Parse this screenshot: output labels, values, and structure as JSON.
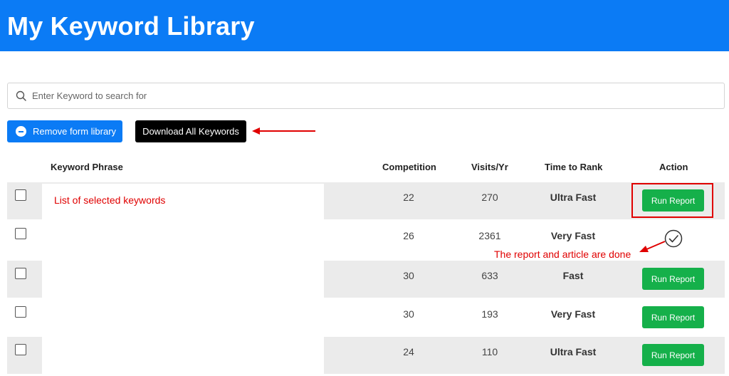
{
  "header": {
    "title": "My Keyword Library"
  },
  "search": {
    "placeholder": "Enter Keyword to search for"
  },
  "toolbar": {
    "remove_label": "Remove form library",
    "download_label": "Download All Keywords"
  },
  "table": {
    "columns": {
      "phrase": "Keyword Phrase",
      "competition": "Competition",
      "visits": "Visits/Yr",
      "time_to_rank": "Time to Rank",
      "action": "Action"
    },
    "rows": [
      {
        "competition": "22",
        "visits": "270",
        "time_to_rank": "Ultra Fast",
        "action": "Run Report"
      },
      {
        "competition": "26",
        "visits": "2361",
        "time_to_rank": "Very Fast",
        "action": "done"
      },
      {
        "competition": "30",
        "visits": "633",
        "time_to_rank": "Fast",
        "action": "Run Report"
      },
      {
        "competition": "30",
        "visits": "193",
        "time_to_rank": "Very Fast",
        "action": "Run Report"
      },
      {
        "competition": "24",
        "visits": "110",
        "time_to_rank": "Ultra Fast",
        "action": "Run Report"
      }
    ]
  },
  "annotations": {
    "keywords_note": "List of selected keywords",
    "done_note": "The report and article are done",
    "color": "#e00000"
  },
  "colors": {
    "brand": "#0b7bf5",
    "run_button": "#15b04a",
    "row_shade": "#ebebeb"
  }
}
